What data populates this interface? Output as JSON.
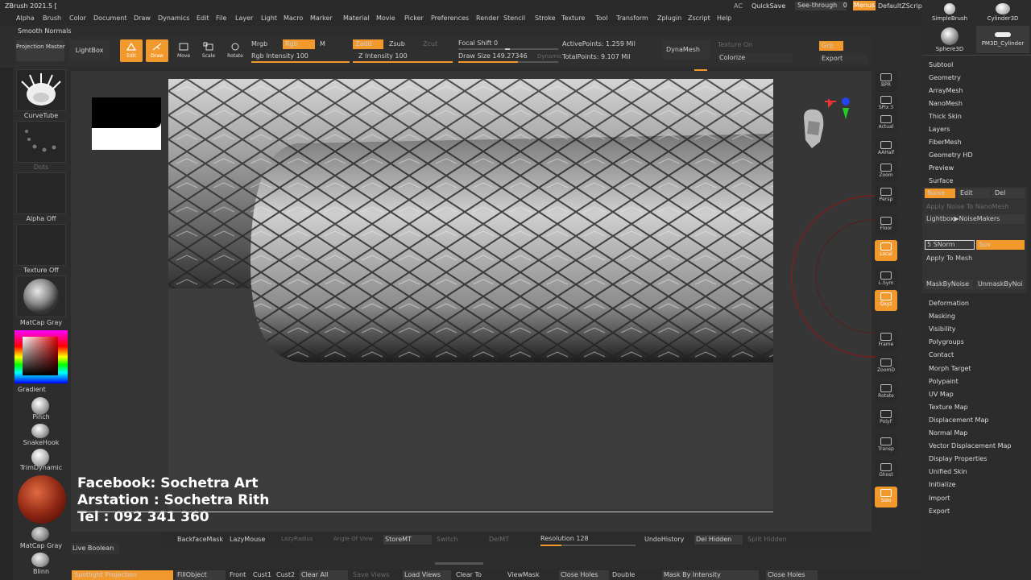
{
  "app": {
    "title": "ZBrush 2021.5 ["
  },
  "menus": [
    "Alpha",
    "Brush",
    "Color",
    "Document",
    "Draw",
    "Dynamics",
    "Edit",
    "File",
    "Layer",
    "Light",
    "Macro",
    "Marker",
    "Material",
    "Movie",
    "Picker",
    "Preferences",
    "Render",
    "Stencil",
    "Stroke",
    "Texture",
    "Tool",
    "Transform",
    "Zplugin",
    "Zscript",
    "Help"
  ],
  "topright": {
    "ac": "AC",
    "quicksave": "QuickSave",
    "seethrough": "See-through",
    "seethrough_val": "0",
    "menus": "Menus",
    "defaultzscript": "DefaultZScript"
  },
  "smooth_normals": "Smooth Normals",
  "toolbar": {
    "projection_master": "Projection Master",
    "lightbox": "LightBox",
    "edit": "Edit",
    "draw": "Draw",
    "move": "Move",
    "scale": "Scale",
    "rotate": "Rotate",
    "mrgb": "Mrgb",
    "rgb": "Rgb",
    "m": "M",
    "rgb_intensity": "Rgb Intensity 100",
    "zadd": "Zadd",
    "zsub": "Zsub",
    "zcut": "Zcut",
    "z_intensity": "Z Intensity 100",
    "focal_shift": "Focal Shift 0",
    "draw_size": "Draw Size 149.27346",
    "dynamic": "Dynamic",
    "active_points": "ActivePoints: 1.259 Mil",
    "total_points": "TotalPoints: 9.107 Mil",
    "dynamesh": "DynaMesh",
    "texture_on": "Texture On",
    "colorize": "Colorize",
    "grp": "Grp",
    "export": "Export"
  },
  "left_shelf": {
    "curvetube": "CurveTube",
    "dots": "Dots",
    "alpha_off": "Alpha Off",
    "texture_off": "Texture Off",
    "matcap_gray": "MatCap Gray",
    "gradient": "Gradient",
    "pinch": "Pinch",
    "snakehook": "SnakeHook",
    "trimdynamic": "TrimDynamic",
    "matcap_gray2": "MatCap Gray",
    "live_boolean": "Live Boolean",
    "blinn": "Blinn"
  },
  "overlay": {
    "line1": "Facebook: Sochetra Art",
    "line2": "Arstation : Sochetra Rith",
    "line3": "Tel : 092 341 360"
  },
  "vertical_toolbar": [
    {
      "label": "BPR",
      "on": false
    },
    {
      "label": "SPix 3",
      "on": false
    },
    {
      "label": "Actual",
      "on": false
    },
    {
      "label": "AAHalf",
      "on": false
    },
    {
      "label": "Zoom",
      "on": false
    },
    {
      "label": "Persp",
      "on": false
    },
    {
      "label": "Floor",
      "on": false
    },
    {
      "label": "Local",
      "on": true
    },
    {
      "label": "L.Sym",
      "on": false
    },
    {
      "label": "Qxyz",
      "on": true
    },
    {
      "label": "Frame",
      "on": false
    },
    {
      "label": "ZoomD",
      "on": false
    },
    {
      "label": "Rotate",
      "on": false
    },
    {
      "label": "PolyF",
      "on": false
    },
    {
      "label": "Transp",
      "on": false
    },
    {
      "label": "Ghost",
      "on": false
    },
    {
      "label": "Solo",
      "on": true
    }
  ],
  "tool_thumbs": {
    "simplebrush": "SimpleBrush",
    "cylinder3d": "Cylinder3D",
    "sphere3d": "Sphere3D",
    "pm3d_cylinder": "PM3D_Cylinder"
  },
  "right_tray": {
    "items_top": [
      "Subtool",
      "Geometry",
      "ArrayMesh",
      "NanoMesh",
      "Thick Skin",
      "Layers",
      "FiberMesh",
      "Geometry HD",
      "Preview",
      "Surface"
    ],
    "noise": "Noise",
    "edit": "Edit",
    "del": "Del",
    "apply_noise_nanomesh": "Apply Noise To NanoMesh",
    "lightbox_noisemakers": "Lightbox▶NoiseMakers",
    "snorm": "5 SNorm",
    "suv": "Suv",
    "apply_to_mesh": "Apply To Mesh",
    "mask_by_noise": "MaskByNoise",
    "unmask_by_noise": "UnmaskByNoi",
    "items_bottom": [
      "Deformation",
      "Masking",
      "Visibility",
      "Polygroups",
      "Contact",
      "Morph Target",
      "Polypaint",
      "UV Map",
      "Texture Map",
      "Displacement Map",
      "Normal Map",
      "Vector Displacement Map",
      "Display Properties",
      "Unified Skin",
      "Initialize",
      "Import",
      "Export"
    ]
  },
  "bottom_bar1": {
    "backfacemask": "BackfaceMask",
    "lazymouse": "LazyMouse",
    "lazyradius": "LazyRadius",
    "angle_of_view": "Angle Of View",
    "storemt": "StoreMT",
    "switch": "Switch",
    "delmt": "DelMT",
    "resolution": "Resolution 128",
    "undohistory": "UndoHistory",
    "delhidden": "Del Hidden",
    "splithidden": "Split Hidden"
  },
  "bottom_bar2": {
    "spotlight": "Spotlight Projection",
    "fillobject": "FillObject",
    "front": "Front",
    "cust1": "Cust1",
    "cust2": "Cust2",
    "clearall": "Clear All",
    "saveviews": "Save Views",
    "loadviews": "Load Views",
    "clearto": "Clear To",
    "viewmask": "ViewMask",
    "closeholes": "Close Holes",
    "double": "Double",
    "maskbyintensity": "Mask By Intensity",
    "closeholes2": "Close Holes"
  },
  "colors": {
    "accent": "#f2992e",
    "background": "#2d2d2d",
    "canvas": "#3a3a3a"
  }
}
